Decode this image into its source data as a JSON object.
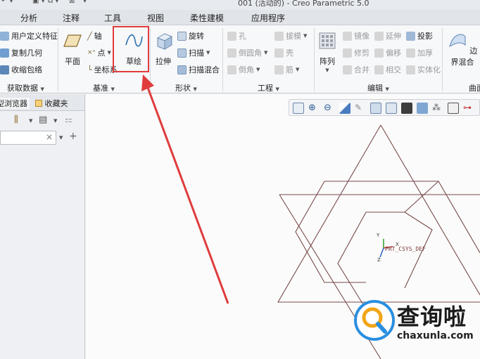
{
  "window": {
    "title": "001 (活动的) - Creo Parametric 5.0"
  },
  "tabs": [
    "分析",
    "注释",
    "工具",
    "视图",
    "柔性建模",
    "应用程序"
  ],
  "ribbon": {
    "get_data": {
      "items": [
        "用户定义特征",
        "复制几何",
        "收缩包络"
      ],
      "label": "获取数据"
    },
    "datum": {
      "plane": "平面",
      "axis": "轴",
      "point": "点",
      "csys": "坐标系",
      "curve": "草绘",
      "label": "基准"
    },
    "shapes": {
      "extrude": "拉伸",
      "revolve": "旋转",
      "sweep": "扫描",
      "swept_blend": "扫描混合",
      "label": "形状"
    },
    "engineering": {
      "items": [
        "孔",
        "倒圆角",
        "倒角",
        "拔模",
        "壳",
        "筋"
      ],
      "label": "工程"
    },
    "editing": {
      "pattern": "阵列",
      "items": [
        "镜像",
        "修剪",
        "合并",
        "延伸",
        "偏移",
        "相交",
        "投影",
        "加厚",
        "实体化"
      ],
      "label": "编辑"
    },
    "surfaces": {
      "boundary_blend": "边界混合",
      "label": "曲面"
    }
  },
  "left_panel": {
    "tabs": [
      "型浏览器",
      "收藏夹"
    ],
    "search_clear": "×"
  },
  "graphics": {
    "csys_label": "PRT_CSYS_DEF",
    "axis_x": "X",
    "axis_y": "Y",
    "axis_z": "Z"
  },
  "watermark": {
    "brand": "查询啦",
    "url": "chaxunla.com"
  },
  "colors": {
    "highlight": "#e03c3c",
    "sketch_line": "#7a4a4a",
    "ribbon_bg": "#f7f8fa",
    "brand_blue": "#2a8fe0"
  }
}
